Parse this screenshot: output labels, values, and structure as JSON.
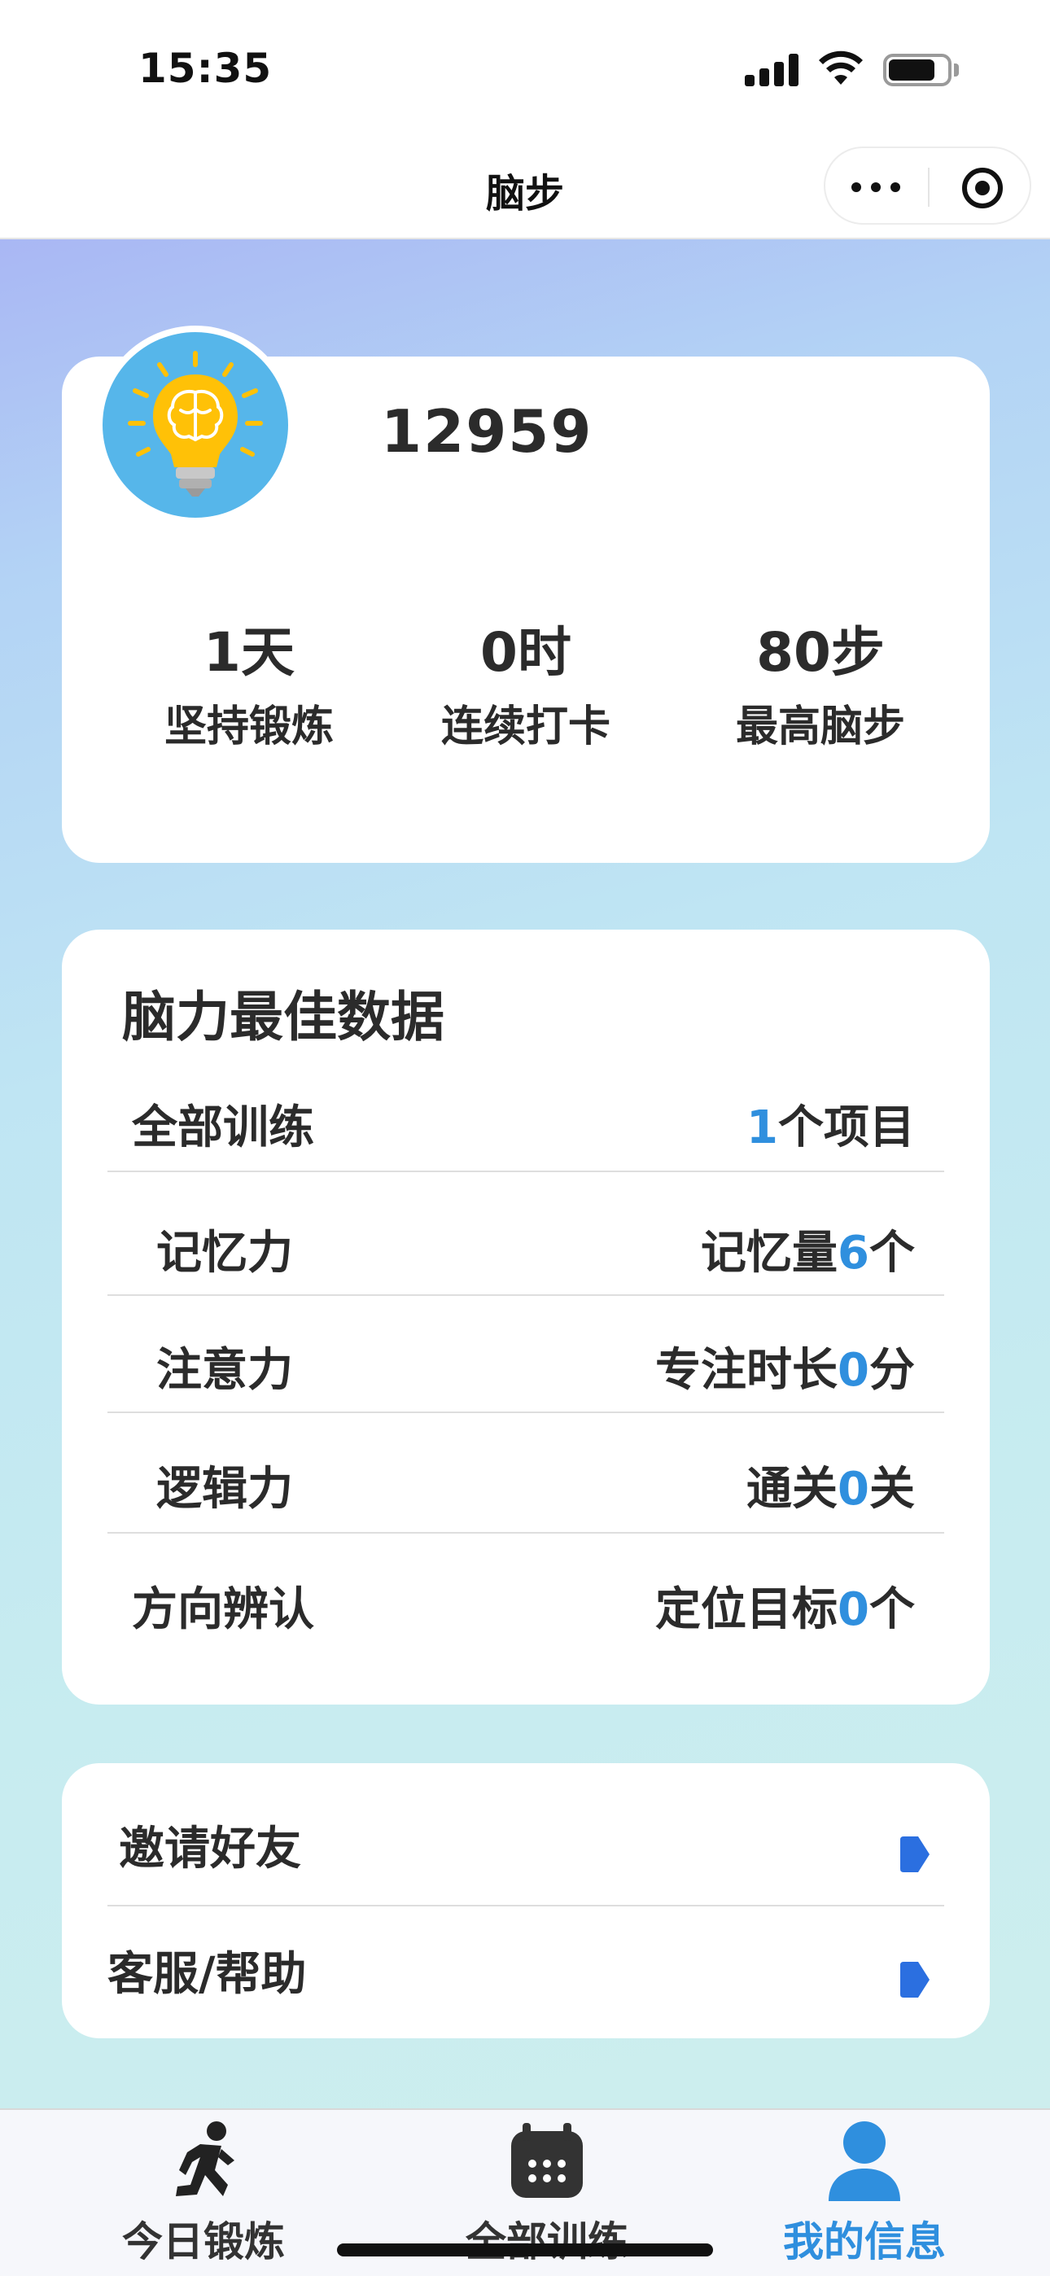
{
  "status_bar": {
    "time": "15:35"
  },
  "nav": {
    "title": "脑步"
  },
  "profile": {
    "user_id": "12959",
    "stats": [
      {
        "value": "1天",
        "label": "坚持锻炼"
      },
      {
        "value": "0时",
        "label": "连续打卡"
      },
      {
        "value": "80步",
        "label": "最高脑步"
      }
    ]
  },
  "best": {
    "title": "脑力最佳数据",
    "rows": [
      {
        "label": "全部训练",
        "prefix": "",
        "number": "1",
        "suffix": "个项目"
      },
      {
        "label": "记忆力",
        "prefix": "记忆量",
        "number": "6",
        "suffix": "个"
      },
      {
        "label": "注意力",
        "prefix": "专注时长",
        "number": "0",
        "suffix": "分"
      },
      {
        "label": "逻辑力",
        "prefix": "通关",
        "number": "0",
        "suffix": "关"
      },
      {
        "label": "方向辨认",
        "prefix": "定位目标",
        "number": "0",
        "suffix": "个"
      }
    ]
  },
  "menu": {
    "items": [
      {
        "label": "邀请好友"
      },
      {
        "label": "客服/帮助"
      }
    ]
  },
  "tabs": [
    {
      "label": "今日锻炼",
      "icon": "runner-icon"
    },
    {
      "label": "全部训练",
      "icon": "calendar-icon"
    },
    {
      "label": "我的信息",
      "icon": "user-icon"
    }
  ],
  "colors": {
    "accent": "#2f8fde",
    "avatar_bg": "#56b6ea",
    "bulb": "#ffc107"
  }
}
